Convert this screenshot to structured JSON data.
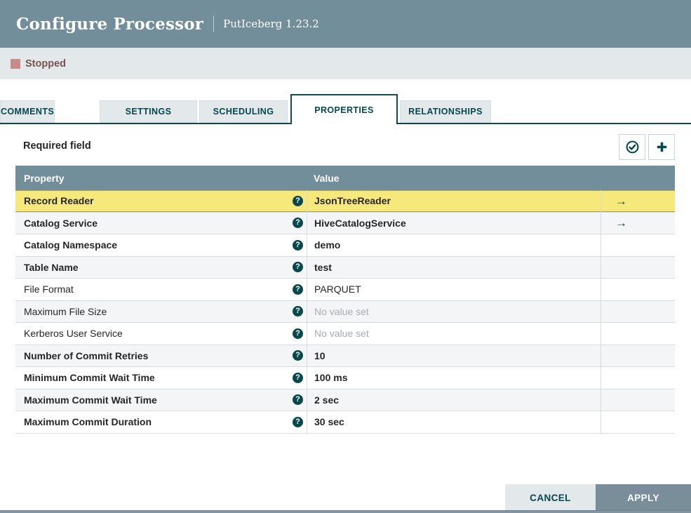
{
  "header": {
    "title": "Configure Processor",
    "subtitle": "PutIceberg 1.23.2"
  },
  "status_bar": {
    "label": "Stopped",
    "status_color": "#C98A8C"
  },
  "tabs": [
    {
      "label": "SETTINGS",
      "active": false
    },
    {
      "label": "SCHEDULING",
      "active": false
    },
    {
      "label": "PROPERTIES",
      "active": true
    },
    {
      "label": "RELATIONSHIPS",
      "active": false
    },
    {
      "label": "COMMENTS",
      "active": false
    }
  ],
  "properties_panel": {
    "required_field_label": "Required field",
    "toolbar": {
      "verify_button_icon": "check-circle-icon",
      "add_button_icon": "plus-icon"
    },
    "table": {
      "columns": [
        "Property",
        "Value"
      ],
      "help_glyph": "?",
      "arrow_glyph": "→",
      "rows": [
        {
          "name": "Record Reader",
          "value": "JsonTreeReader",
          "required": true,
          "unset": false,
          "has_arrow": true,
          "selected": true
        },
        {
          "name": "Catalog Service",
          "value": "HiveCatalogService",
          "required": true,
          "unset": false,
          "has_arrow": true,
          "selected": false
        },
        {
          "name": "Catalog Namespace",
          "value": "demo",
          "required": true,
          "unset": false,
          "has_arrow": false,
          "selected": false
        },
        {
          "name": "Table Name",
          "value": "test",
          "required": true,
          "unset": false,
          "has_arrow": false,
          "selected": false
        },
        {
          "name": "File Format",
          "value": "PARQUET",
          "required": false,
          "unset": false,
          "has_arrow": false,
          "selected": false
        },
        {
          "name": "Maximum File Size",
          "value": "No value set",
          "required": false,
          "unset": true,
          "has_arrow": false,
          "selected": false
        },
        {
          "name": "Kerberos User Service",
          "value": "No value set",
          "required": false,
          "unset": true,
          "has_arrow": false,
          "selected": false
        },
        {
          "name": "Number of Commit Retries",
          "value": "10",
          "required": true,
          "unset": false,
          "has_arrow": false,
          "selected": false
        },
        {
          "name": "Minimum Commit Wait Time",
          "value": "100 ms",
          "required": true,
          "unset": false,
          "has_arrow": false,
          "selected": false
        },
        {
          "name": "Maximum Commit Wait Time",
          "value": "2 sec",
          "required": true,
          "unset": false,
          "has_arrow": false,
          "selected": false
        },
        {
          "name": "Maximum Commit Duration",
          "value": "30 sec",
          "required": true,
          "unset": false,
          "has_arrow": false,
          "selected": false
        }
      ]
    },
    "footer": {
      "cancel_label": "CANCEL",
      "apply_label": "APPLY"
    }
  },
  "colors": {
    "header_bg": "#728E9B",
    "accent_teal": "#07484D",
    "selected_row_bg": "#F7E87C",
    "alt_row_bg": "#F3F5F7",
    "status_bar_bg": "#E3E8EB"
  }
}
